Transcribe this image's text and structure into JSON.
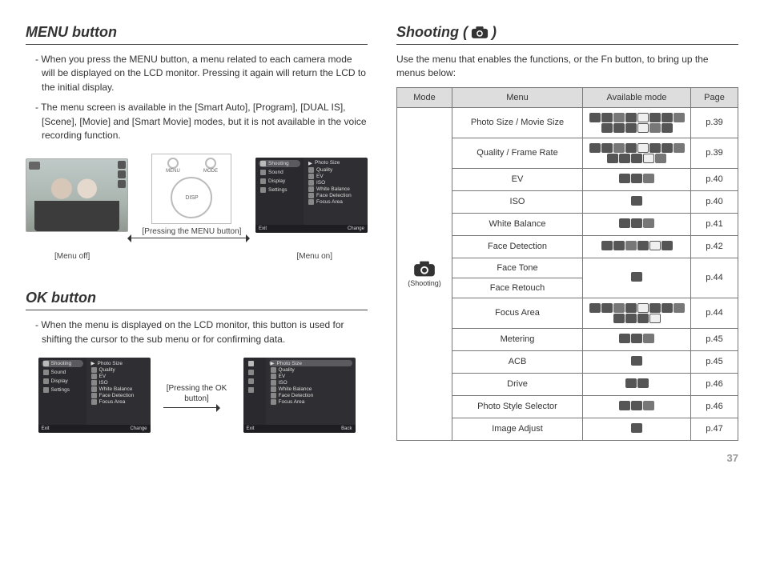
{
  "page_number": "37",
  "left": {
    "menu_button": {
      "heading": "MENU button",
      "bullets": [
        "When you press the MENU button, a menu related to each camera mode will be displayed on the LCD monitor. Pressing it again will return the LCD to the initial display.",
        "The menu screen is available in the [Smart Auto], [Program], [DUAL IS], [Scene], [Movie] and [Smart Movie] modes, but it is not available in the voice recording function."
      ],
      "control_labels": {
        "left_btn": "MENU",
        "right_btn": "MODE",
        "disp": "DISP"
      },
      "caption_pressing": "[Pressing the MENU button]",
      "caption_off": "[Menu off]",
      "caption_on": "[Menu on]"
    },
    "ok_button": {
      "heading": "OK button",
      "bullets": [
        "When the menu is displayed on the LCD monitor, this button is used for shifting the cursor to the sub menu or for confirming data."
      ],
      "caption_pressing": "[Pressing the OK button]"
    },
    "menu_panels": {
      "left_items": [
        "Shooting",
        "Sound",
        "Display",
        "Settings"
      ],
      "right_items": [
        "Photo Size",
        "Quality",
        "EV",
        "ISO",
        "White Balance",
        "Face Detection",
        "Focus Area"
      ],
      "footer_exit": "Exit",
      "footer_change": "Change",
      "footer_back": "Back"
    }
  },
  "right": {
    "heading_prefix": "Shooting (",
    "heading_suffix": ")",
    "intro": "Use the menu that enables the functions, or the Fn button, to bring up the menus below:",
    "table": {
      "headers": {
        "mode": "Mode",
        "menu": "Menu",
        "available": "Available mode",
        "page": "Page"
      },
      "mode_label": "(Shooting)",
      "rows": [
        {
          "menu": "Photo Size / Movie Size",
          "icon_count": 14,
          "page": "p.39"
        },
        {
          "menu": "Quality / Frame Rate",
          "icon_count": 13,
          "page": "p.39"
        },
        {
          "menu": "EV",
          "icon_count": 3,
          "page": "p.40"
        },
        {
          "menu": "ISO",
          "icon_count": 1,
          "page": "p.40"
        },
        {
          "menu": "White Balance",
          "icon_count": 3,
          "page": "p.41"
        },
        {
          "menu": "Face Detection",
          "icon_count": 6,
          "page": "p.42"
        },
        {
          "menu": "Face Tone",
          "icon_count": 1,
          "page": "p.44",
          "rowspan_avail": 2,
          "rowspan_page": 2
        },
        {
          "menu": "Face Retouch",
          "skip_avail": true,
          "skip_page": true
        },
        {
          "menu": "Focus Area",
          "icon_count": 12,
          "page": "p.44"
        },
        {
          "menu": "Metering",
          "icon_count": 3,
          "page": "p.45"
        },
        {
          "menu": "ACB",
          "icon_count": 1,
          "page": "p.45"
        },
        {
          "menu": "Drive",
          "icon_count": 2,
          "page": "p.46"
        },
        {
          "menu": "Photo Style Selector",
          "icon_count": 3,
          "page": "p.46"
        },
        {
          "menu": "Image Adjust",
          "icon_count": 1,
          "page": "p.47"
        }
      ]
    }
  }
}
